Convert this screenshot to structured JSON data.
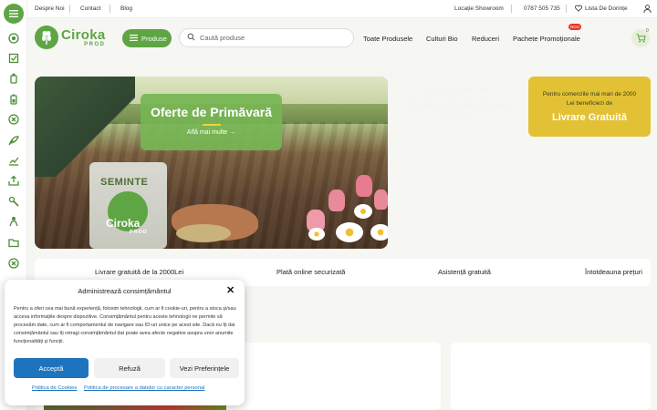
{
  "topbar": {
    "links": [
      "Despre Noi",
      "Contact",
      "Blog"
    ],
    "showroom": "Locație Showroom",
    "phone": "0787 505 735",
    "wishlist": "Lista De Dorințe"
  },
  "header": {
    "logo_main": "Ciroka",
    "logo_sub": "PROD",
    "products_button": "Produse",
    "search_placeholder": "Caută produse",
    "nav": [
      "Toate Produsele",
      "Culturi Bio",
      "Reduceri",
      "Pachete Promoționale"
    ],
    "new_badge": "NOU",
    "cart_count": "0"
  },
  "hero": {
    "title": "Oferte de Primăvară",
    "link": "Află mai multe →",
    "bag_label": "SEMINTE",
    "bag_brand": "Ciroka",
    "bag_sub": "PROD"
  },
  "promo": {
    "line1": "Economisește Mai Mult cu",
    "line2": "Pachete Promoționale",
    "line3": "Vezi Pachete"
  },
  "shipping_banner": {
    "line1": "Pentru comenzile mai mari de 2000",
    "line2": "Lei beneficiezi de",
    "big": "Livrare Gratuită"
  },
  "features": [
    "Livrare gratuită de la 2000Lei",
    "Plată online securizată",
    "Asistență gratuită",
    "Întotdeauna prețuri"
  ],
  "consent": {
    "title": "Administrează consimțământul",
    "text": "Pentru a oferi cea mai bună experiență, folosim tehnologii, cum ar fi cookie-uri, pentru a stoca și/sau accesa informațiile despre dispozitive. Consimțământul pentru aceste tehnologii ne permite să procesăm date, cum ar fi comportamentul de navigare sau ID-uri unice pe acest site. Dacă nu îți dai consimțământul sau îți retragi consimțământul dat poate avea afecte negative asupra unor anumite funcționalități și funcții.",
    "accept": "Acceptă",
    "refuse": "Refuză",
    "preferences": "Vezi Preferințele",
    "cookie_policy": "Politica de Cookies",
    "privacy_policy": "Politica de procesare a datelor cu caracter personal"
  },
  "colors": {
    "brand_green": "#5ea544",
    "gold": "#e2c234",
    "accept_blue": "#1e73be",
    "new_red": "#e4352b"
  },
  "rail_icons": [
    "menu-icon",
    "leaf-circle-icon",
    "checkbox-icon",
    "bottle-icon",
    "battery-icon",
    "cancel-circle-icon",
    "sprout-icon",
    "chart-icon",
    "upload-tray-icon",
    "tools-icon",
    "people-icon",
    "folder-icon",
    "cancel-circle-icon"
  ]
}
